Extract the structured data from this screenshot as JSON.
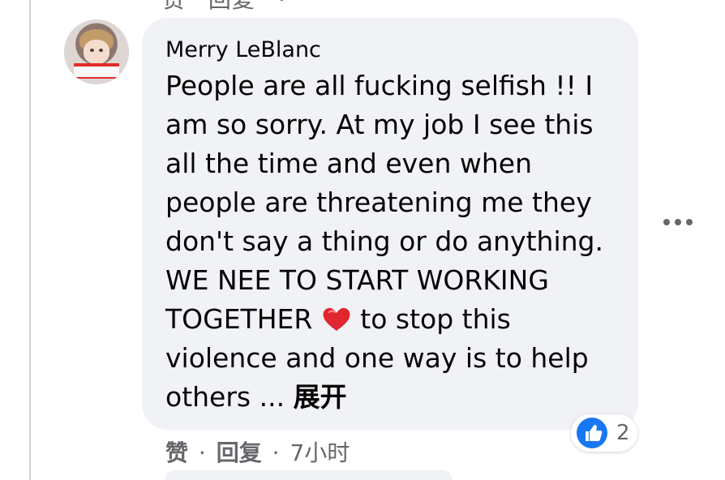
{
  "top": {
    "action_like": "赞",
    "action_reply": "回复",
    "action_meta": "·"
  },
  "comment": {
    "author": "Merry LeBlanc",
    "text_before_heart": "People are all fucking selfish !! I am so sorry. At my job I see this all the time and even when people are threatening me they don't say a thing or do anything. WE NEE TO START WORKING TOGETHER ",
    "text_after_heart": " to stop this violence and one way is to help others ... ",
    "expand_label": "展开",
    "reaction_count": "2",
    "like_label": "赞",
    "reply_label": "回复",
    "separator": "·",
    "timestamp": "7小时"
  },
  "icons": {
    "avatar": "profile-avatar",
    "heart": "red-heart-emoji",
    "like": "thumbs-up-icon",
    "more": "more-options-icon"
  },
  "colors": {
    "bubble_background": "#f0f2f5",
    "secondary_text": "#65676b",
    "like_blue": "#1877f2",
    "heart_red": "#e0262f"
  }
}
